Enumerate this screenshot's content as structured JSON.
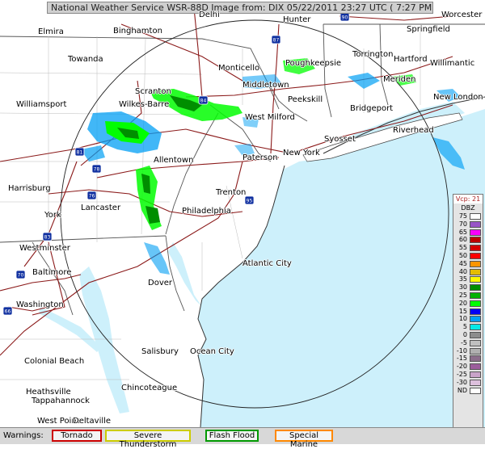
{
  "title_bar": "National Weather Service WSR-88D Image  from: DIX 05/22/2011  23:27 UTC ( 7:27 PM EDT)",
  "route_shields": {
    "i90": "90",
    "i87": "87",
    "i84": "84",
    "i81": "81",
    "i78": "78",
    "i76": "76",
    "i83": "83",
    "i70": "70",
    "i95": "95",
    "i66": "66"
  },
  "cities": [
    "Elmira",
    "Binghamton",
    "Delhi",
    "Hunter",
    "Worcester",
    "Springfield",
    "Towanda",
    "Monticello",
    "Poughkeepsie",
    "Torrington",
    "Hartford",
    "Willimantic",
    "Middletown",
    "Meriden",
    "Scranton",
    "Williamsport",
    "Wilkes-Barre",
    "Peekskill",
    "Bridgeport",
    "New London",
    "West Milford",
    "Riverhead",
    "Syosset",
    "New York",
    "Paterson",
    "Allentown",
    "Harrisburg",
    "Trenton",
    "Lancaster",
    "York",
    "Philadelphia",
    "Westminster",
    "Atlantic City",
    "Baltimore",
    "Dover",
    "Washington",
    "Salisbury",
    "Ocean City",
    "Colonial Beach",
    "Chincoteague",
    "Heathsville",
    "Tappahannock",
    "West Point",
    "Deltaville"
  ],
  "legend": {
    "vcp": "Vcp: 21",
    "units": "DBZ",
    "levels": [
      {
        "label": "75",
        "color": "#ffffff"
      },
      {
        "label": "70",
        "color": "#9854c6"
      },
      {
        "label": "65",
        "color": "#f800fd"
      },
      {
        "label": "60",
        "color": "#bc0000"
      },
      {
        "label": "55",
        "color": "#d40000"
      },
      {
        "label": "50",
        "color": "#fd0000"
      },
      {
        "label": "45",
        "color": "#fd9500"
      },
      {
        "label": "40",
        "color": "#e5bc00"
      },
      {
        "label": "35",
        "color": "#fdf802"
      },
      {
        "label": "30",
        "color": "#008e00"
      },
      {
        "label": "25",
        "color": "#01b101"
      },
      {
        "label": "20",
        "color": "#02fd02"
      },
      {
        "label": "15",
        "color": "#0300f4"
      },
      {
        "label": "10",
        "color": "#019ff4"
      },
      {
        "label": "5",
        "color": "#04e9e7"
      },
      {
        "label": "0",
        "color": "#8c8c8c"
      },
      {
        "label": "-5",
        "color": "#c0c0c0"
      },
      {
        "label": "-10",
        "color": "#b0b0b0"
      },
      {
        "label": "-15",
        "color": "#8b6e8b"
      },
      {
        "label": "-20",
        "color": "#9c5d9c"
      },
      {
        "label": "-25",
        "color": "#c9a3c9"
      },
      {
        "label": "-30",
        "color": "#ddc0dd"
      },
      {
        "label": "ND",
        "color": "#ffffff"
      }
    ]
  },
  "warnings": {
    "title": "Warnings:",
    "items": [
      {
        "label": "Tornado",
        "color": "#cc0000"
      },
      {
        "label": "Severe Thunderstorm",
        "color": "#cccc00"
      },
      {
        "label": "Flash Flood",
        "color": "#009900"
      },
      {
        "label": "Special Marine",
        "color": "#ff8800"
      }
    ]
  }
}
